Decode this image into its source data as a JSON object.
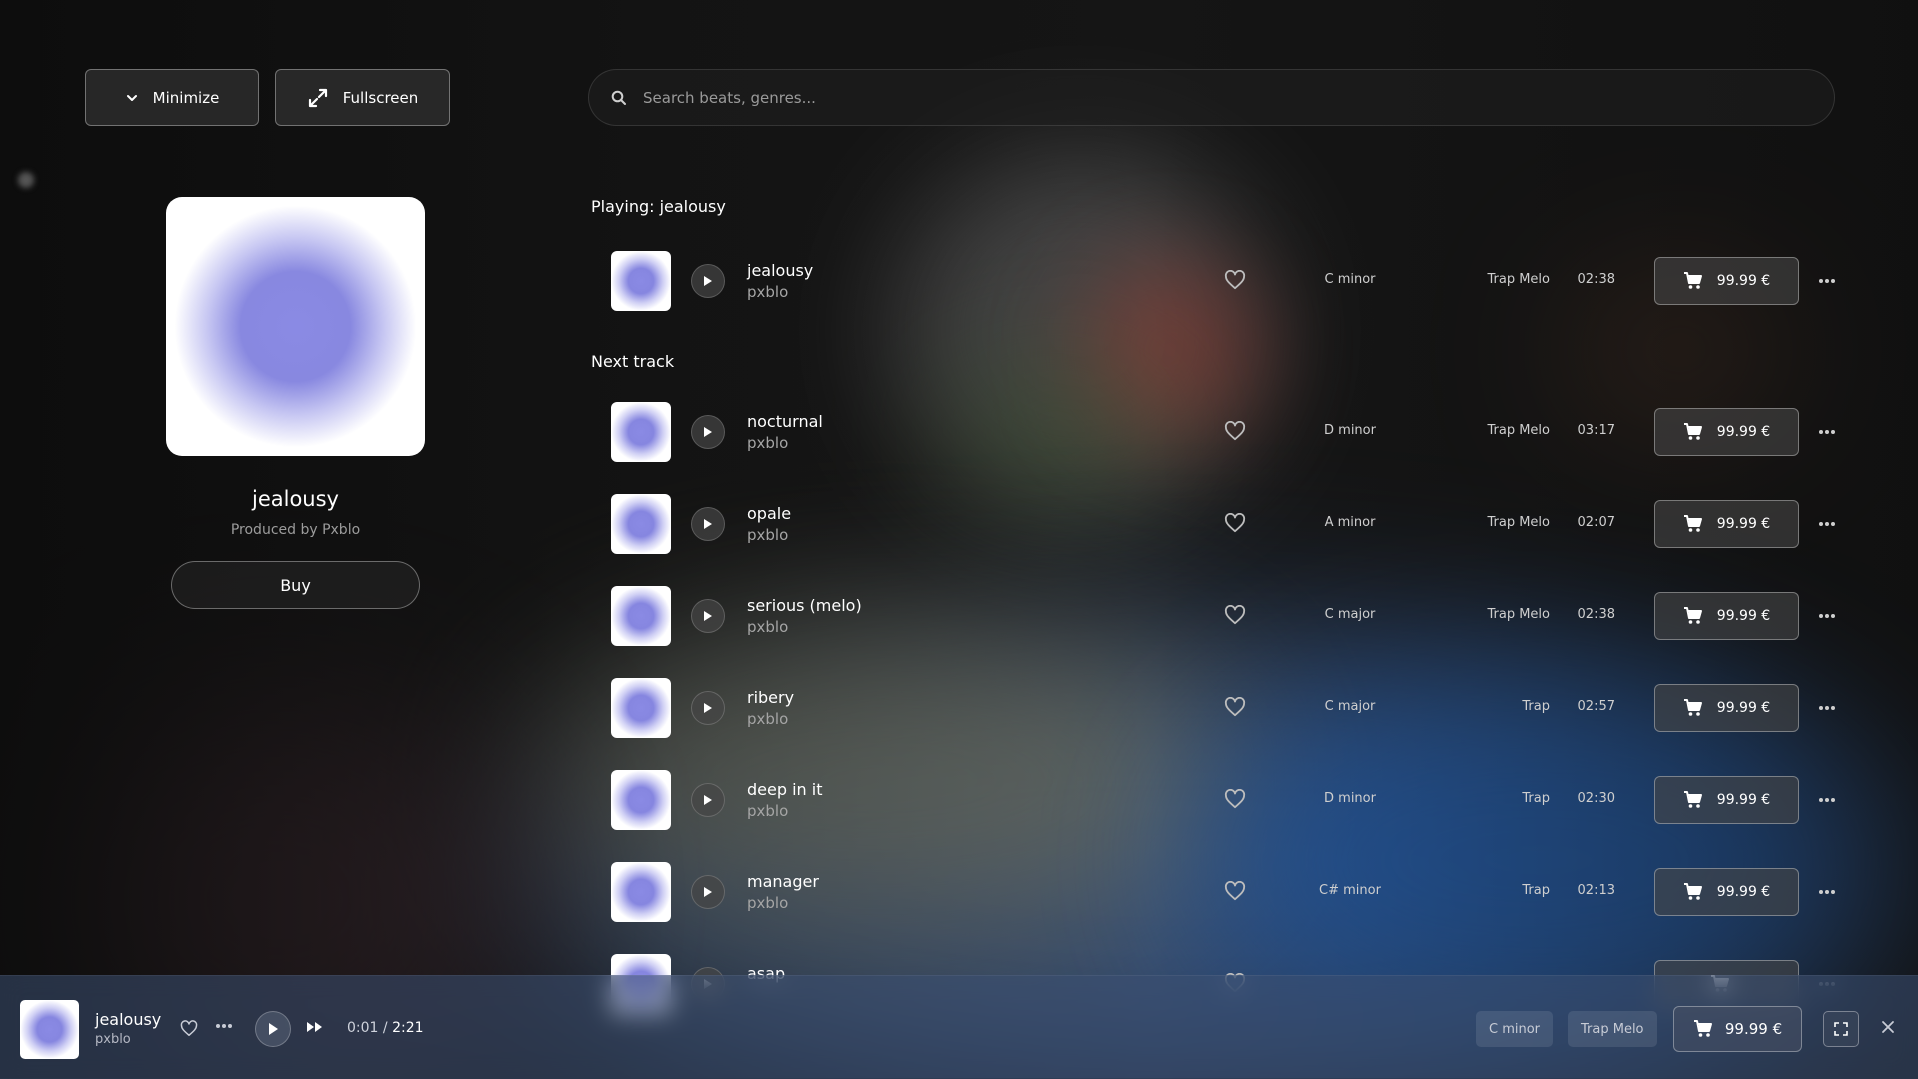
{
  "header": {
    "minimize_label": "Minimize",
    "fullscreen_label": "Fullscreen",
    "search_placeholder": "Search beats, genres..."
  },
  "now_playing_card": {
    "title": "jealousy",
    "producer": "Produced by Pxblo",
    "buy_label": "Buy"
  },
  "sections": {
    "playing": "Playing: jealousy",
    "next": "Next track"
  },
  "playing_track": {
    "name": "jealousy",
    "artist": "pxblo",
    "key": "C minor",
    "genre": "Trap Melo",
    "duration": "02:38",
    "price": "99.99 €"
  },
  "tracks": [
    {
      "name": "nocturnal",
      "artist": "pxblo",
      "key": "D minor",
      "genre": "Trap Melo",
      "duration": "03:17",
      "price": "99.99 €"
    },
    {
      "name": "opale",
      "artist": "pxblo",
      "key": "A minor",
      "genre": "Trap Melo",
      "duration": "02:07",
      "price": "99.99 €"
    },
    {
      "name": "serious (melo)",
      "artist": "pxblo",
      "key": "C major",
      "genre": "Trap Melo",
      "duration": "02:38",
      "price": "99.99 €"
    },
    {
      "name": "ribery",
      "artist": "pxblo",
      "key": "C major",
      "genre": "Trap",
      "duration": "02:57",
      "price": "99.99 €"
    },
    {
      "name": "deep in it",
      "artist": "pxblo",
      "key": "D minor",
      "genre": "Trap",
      "duration": "02:30",
      "price": "99.99 €"
    },
    {
      "name": "manager",
      "artist": "pxblo",
      "key": "C# minor",
      "genre": "Trap",
      "duration": "02:13",
      "price": "99.99 €"
    },
    {
      "name": "asap",
      "artist": "",
      "key": "",
      "genre": "",
      "duration": "",
      "price": ""
    }
  ],
  "player": {
    "title": "jealousy",
    "artist": "pxblo",
    "current_time": "0:01",
    "separator": "/",
    "total_time": "2:21",
    "key": "C minor",
    "genre": "Trap Melo",
    "price": "99.99 €"
  },
  "icons": {
    "minimize": "chevron-down-icon",
    "fullscreen": "expand-arrows-icon",
    "search": "search-icon",
    "play": "play-icon",
    "heart": "heart-icon",
    "cart": "cart-icon",
    "more": "more-dots-icon",
    "next": "fast-forward-icon",
    "expand": "expand-icon",
    "close": "close-icon"
  }
}
